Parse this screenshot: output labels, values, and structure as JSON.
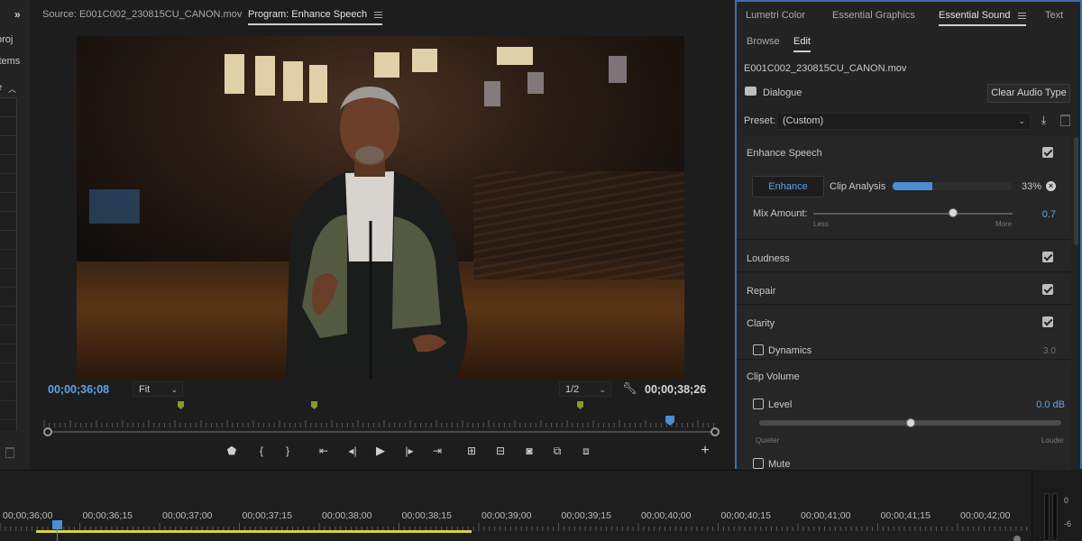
{
  "project_panel": {
    "label_proj": "proj",
    "label_items": "items",
    "label_sort": "e"
  },
  "monitor": {
    "source_tab": "Source: E001C002_230815CU_CANON.mov",
    "program_tab": "Program: Enhance Speech",
    "current_tc": "00;00;36;08",
    "zoom": "Fit",
    "resolution": "1/2",
    "duration_tc": "00;00;38;26",
    "playhead_color": "#4a8ed6",
    "marker_color": "#8a9a2a"
  },
  "panel": {
    "tabs": [
      "Lumetri Color",
      "Essential Graphics",
      "Essential Sound",
      "Text"
    ],
    "subtabs": [
      "Browse",
      "Edit"
    ],
    "clip_name": "E001C002_230815CU_CANON.mov",
    "audio_type": "Dialogue",
    "clear_btn": "Clear Audio Type",
    "preset_label": "Preset:",
    "preset_value": "(Custom)",
    "enhance": {
      "title": "Enhance Speech",
      "button": "Enhance",
      "analysis_label": "Clip Analysis",
      "analysis_pct": "33%",
      "analysis_progress": 0.33,
      "mix_label": "Mix Amount:",
      "mix_less": "Less",
      "mix_more": "More",
      "mix_value": "0.7",
      "mix_fraction": 0.7
    },
    "loudness": "Loudness",
    "repair": "Repair",
    "clarity": "Clarity",
    "dynamics": "Dynamics",
    "dynamics_value": "3.0",
    "clip_volume": "Clip Volume",
    "level": "Level",
    "level_value": "0.0 dB",
    "level_fraction": 0.5,
    "quieter": "Quieter",
    "louder": "Louder",
    "mute": "Mute",
    "accent": "#5ea3ea"
  },
  "timeline": {
    "labels": [
      "00;00;36;00",
      "00;00;36;15",
      "00;00;37;00",
      "00;00;37;15",
      "00;00;38;00",
      "00;00;38;15",
      "00;00;39;00",
      "00;00;39;15",
      "00;00;40;00",
      "00;00;40;15",
      "00;00;41;00",
      "00;00;41;15",
      "00;00;42;00"
    ]
  },
  "meter": {
    "labels": [
      "0",
      "-6"
    ]
  }
}
